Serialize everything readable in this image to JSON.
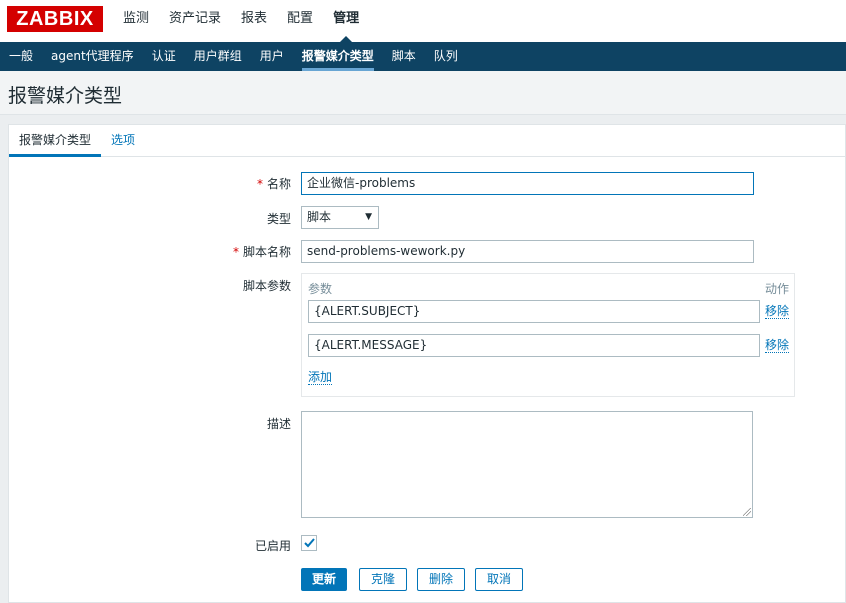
{
  "logo": "ZABBIX",
  "main_menu": [
    {
      "label": "监测"
    },
    {
      "label": "资产记录"
    },
    {
      "label": "报表"
    },
    {
      "label": "配置"
    },
    {
      "label": "管理",
      "active": true
    }
  ],
  "sub_menu": [
    {
      "label": "一般"
    },
    {
      "label": "agent代理程序"
    },
    {
      "label": "认证"
    },
    {
      "label": "用户群组"
    },
    {
      "label": "用户"
    },
    {
      "label": "报警媒介类型",
      "active": true
    },
    {
      "label": "脚本"
    },
    {
      "label": "队列"
    }
  ],
  "page_title": "报警媒介类型",
  "tabs": {
    "media_type": "报警媒介类型",
    "options": "选项"
  },
  "form": {
    "required_mark": "*",
    "name_label": "名称",
    "name_value": "企业微信-problems",
    "type_label": "类型",
    "type_value": "脚本",
    "script_name_label": "脚本名称",
    "script_name_value": "send-problems-wework.py",
    "script_params_label": "脚本参数",
    "params_header": "参数",
    "action_header": "动作",
    "params": [
      {
        "value": "{ALERT.SUBJECT}",
        "remove": "移除"
      },
      {
        "value": "{ALERT.MESSAGE}",
        "remove": "移除"
      }
    ],
    "add_label": "添加",
    "description_label": "描述",
    "description_value": "",
    "enabled_label": "已启用",
    "enabled": true
  },
  "buttons": {
    "update": "更新",
    "clone": "克隆",
    "delete": "删除",
    "cancel": "取消"
  },
  "colors": {
    "brand": "#d40000",
    "nav": "#0e4363",
    "accent": "#0275b8"
  }
}
